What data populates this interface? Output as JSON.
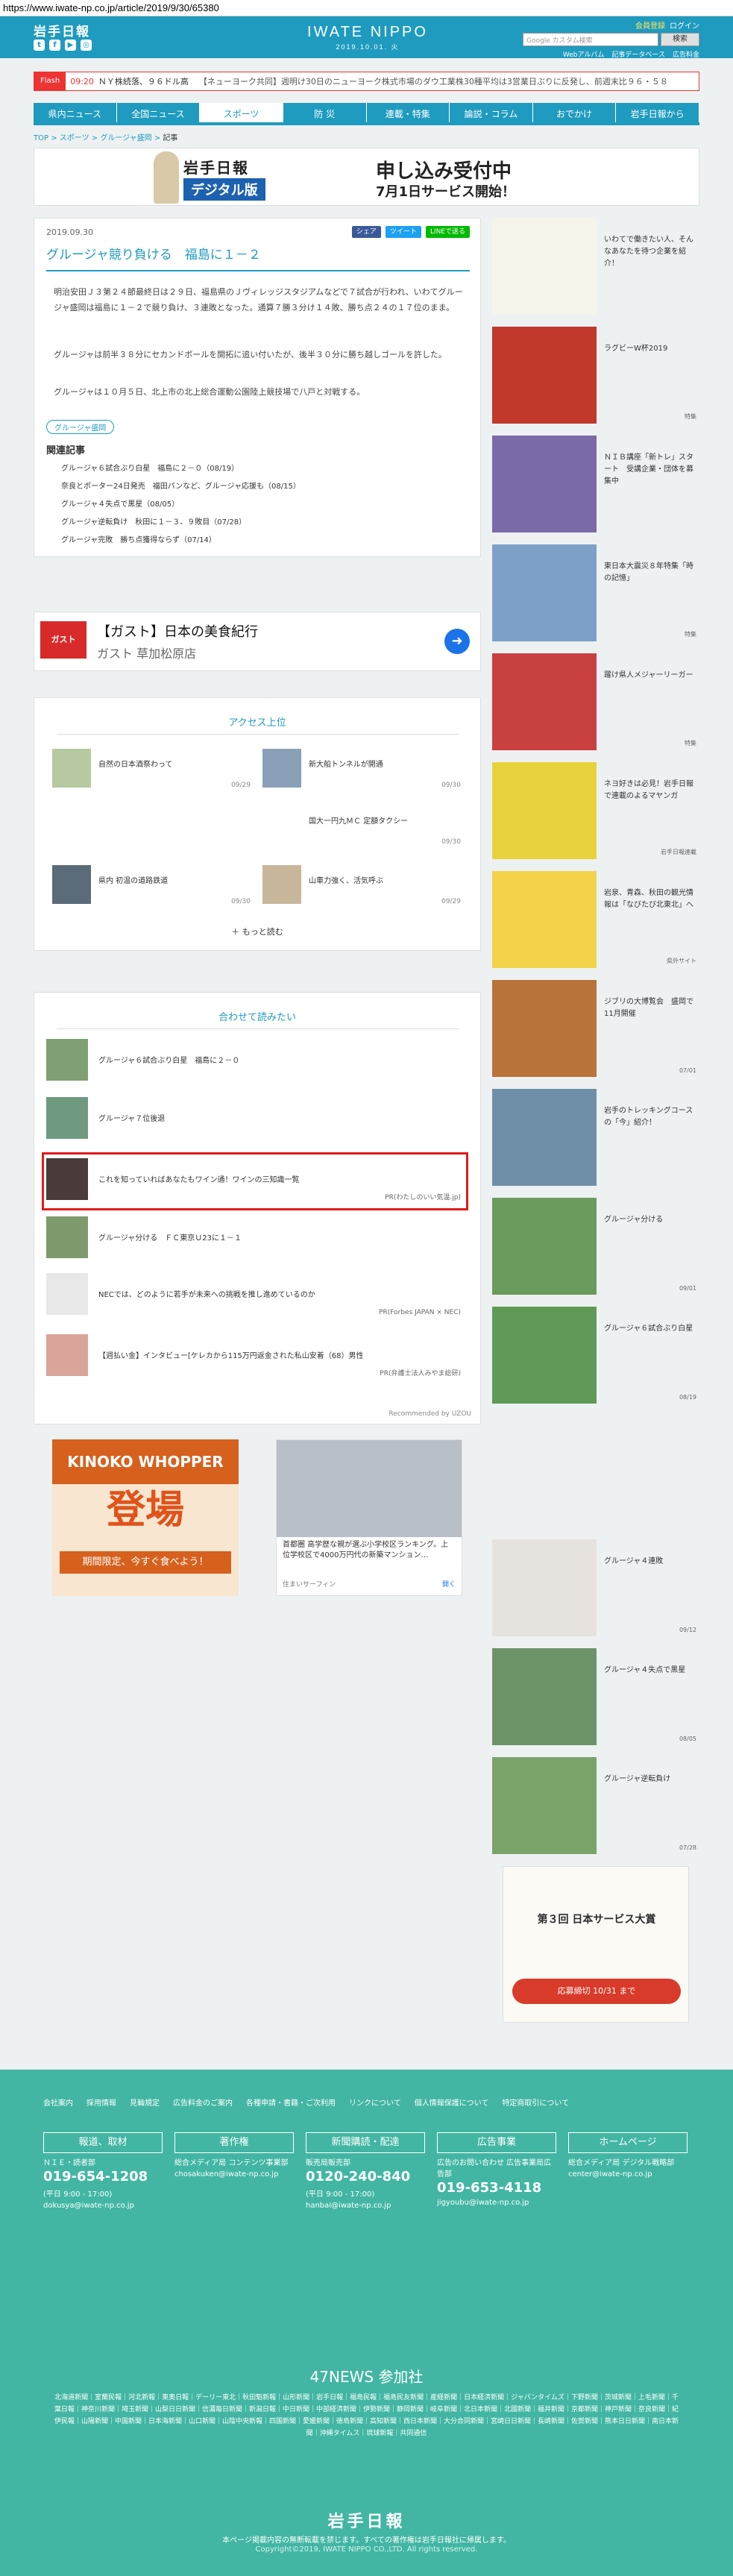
{
  "url": "https://www.iwate-np.co.jp/article/2019/9/30/65380",
  "header": {
    "logo": "岩手日報",
    "brand": "IWATE NIPPO",
    "date": "2019.10.01. 火",
    "member": "会員登録",
    "login": "ログイン",
    "search_placeholder": "Google カスタム検索",
    "search_button": "検索",
    "sublinks": [
      "Webアルバム",
      "記事データベース",
      "広告料金"
    ]
  },
  "flash": {
    "tag": "Flash",
    "time": "09:20",
    "text": "ＮＹ株続落、９６ドル高",
    "text2": "【ネューヨーク共同】週明け30日のニューヨーク株式市場のダウ工業株30種平均は3営業日ぶりに反発し、前週末比９６・５８"
  },
  "nav": [
    "県内ニュース",
    "全国ニュース",
    "スポーツ",
    "防 災",
    "連載・特集",
    "論説・コラム",
    "おでかけ",
    "岩手日報から"
  ],
  "breadcrumb": {
    "items": [
      "TOP",
      "スポーツ",
      "グルージャ盛岡"
    ],
    "current": "記事"
  },
  "banner": {
    "line1": "岩手日報",
    "line2": "デジタル版",
    "line3": "申し込み受付中",
    "line4": "7月1日サービス開始！"
  },
  "article": {
    "date": "2019.09.30",
    "share": [
      "シェア",
      "ツイート",
      "LINEで送る"
    ],
    "title": "グルージャ競り負ける　福島に１－２",
    "paragraphs": [
      "明治安田Ｊ３第２４節最終日は２９日、福島県のＪヴィレッジスタジアムなどで７試合が行われ、いわてグルージャ盛岡は福島に１－２で競り負け、３連敗となった。通算７勝３分け１４敗、勝ち点２４の１７位のまま。",
      "グルージャは前半３８分にセカンドボールを開拓に追い付いたが、後半３０分に勝ち越しゴールを許した。",
      "グルージャは１０月５日、北上市の北上総合運動公園陸上競技場で八戸と対戦する。"
    ],
    "tag": "グルージャ盛岡",
    "related_heading": "関連記事",
    "related": [
      "グルージャ６試合ぶり白星　福島に２－０（08/19）",
      "奈良とポーター24日発売　福田パンなど、グルージャ応援も（08/15）",
      "グルージャ４失点で黒星（08/05）",
      "グルージャ逆転負け　秋田に１－３、９敗目（07/28）",
      "グルージャ完敗　勝ち点獲得ならず（07/14）"
    ]
  },
  "ad_gusto": {
    "logo": "ガスト",
    "title": "【ガスト】日本の美食紀行",
    "subtitle": "ガスト 草加松原店"
  },
  "access": {
    "heading": "アクセス上位",
    "items": [
      {
        "text": "自然の日本酒祭わって",
        "date": "09/29"
      },
      {
        "text": "新大船トンネルが開通",
        "date": "09/30"
      },
      {
        "text": "",
        "date": ""
      },
      {
        "text": "国大一円九ＭＣ 定額タクシー",
        "date": "09/30"
      },
      {
        "text": "県内 初温の道路鉄道",
        "date": "09/30"
      },
      {
        "text": "山車力強く、活気呼ぶ",
        "date": "09/29"
      }
    ],
    "more": "もっと読む"
  },
  "recommend": {
    "heading": "合わせて読みたい",
    "items": [
      {
        "text": "グルージャ６試合ぶり白星　福島に２－０",
        "pr": ""
      },
      {
        "text": "グルージャ７位後退",
        "pr": ""
      },
      {
        "text": "これを知っていればあなたもワイン通！ワインの三知識一覧",
        "pr": "PR(わたしのいい気温.jp)"
      },
      {
        "text": "グルージャ分ける　ＦＣ東京Ｕ23に１－１",
        "pr": ""
      },
      {
        "text": "NECでは、どのように若手が未来への挑戦を推し進めているのか",
        "pr": "PR(Forbes JAPAN × NEC)"
      },
      {
        "text": "【週払い金】インタビュー[ケレカから115万円返金された私山安着（68）男性",
        "pr": "PR(弁護士法人みやま総研)"
      }
    ],
    "powered": "Recommended by UZOU"
  },
  "ad_burger": {
    "title": "KINOKO WHOPPER",
    "sub": "登場",
    "line": "期間限定、今すぐ食べよう！"
  },
  "ad_house": {
    "text": "首都圏 高学歴な親が選ぶ小学校区ランキング。上位学校区で4000万円代の新築マンション…",
    "source": "住まいサーフィン",
    "cta": "開く"
  },
  "sidebar": [
    {
      "text": "いわてで働きたい人、そんなあなたを待つ企業を紹介！",
      "label": ""
    },
    {
      "text": "ラグビーW杯2019",
      "label": "特集"
    },
    {
      "text": "ＮＩＢ講座「新トレ」スタート　受講企業・団体を募集中",
      "label": ""
    },
    {
      "text": "東日本大震災８年特集「時の記憶」",
      "label": "特集"
    },
    {
      "text": "躍け県人メジャーリーガー",
      "label": "特集"
    },
    {
      "text": "ネヨ好きは必見！岩手日報で連載のよるマヤンガ",
      "label": "岩手日報連載"
    },
    {
      "text": "岩泉、青森、秋田の観光情報は「なびたび北東北」へ",
      "label": "県外サイト"
    },
    {
      "text": "ジブリの大博覧会　盛岡で11月開催",
      "label": "07/01"
    },
    {
      "text": "岩手のトレッキングコースの「今」紹介！",
      "label": ""
    },
    {
      "text": "グルージャ分ける",
      "label": "09/01"
    },
    {
      "text": "グルージャ６試合ぶり白星",
      "label": "08/19"
    },
    {
      "text": "グルージャ４連敗",
      "label": "09/12"
    },
    {
      "text": "グルージャ４失点で黒星",
      "label": "08/05"
    },
    {
      "text": "グルージャ逆転負け",
      "label": "07/28"
    }
  ],
  "sidebar_ad": {
    "line1": "第３回 日本サービス大賞",
    "line2": "応募締切 10/31 まで"
  },
  "footer": {
    "links": [
      "会社案内",
      "採用情報",
      "見輪規定",
      "広告料金のご案内",
      "各種申請・書籍・ご次利用",
      "リンクについて",
      "個人情報保護について",
      "特定商取引について"
    ],
    "cols": [
      {
        "head": "報道、取材",
        "sub": "ＮＩＥ・読者部",
        "phone": "019-654-1208",
        "hours": "(平日 9:00 - 17:00)",
        "mail": "dokusya@iwate-np.co.jp"
      },
      {
        "head": "著作権",
        "sub": "総合メディア局 コンテンツ事業部",
        "phone": "",
        "hours": "",
        "mail": "chosakuken@iwate-np.co.jp"
      },
      {
        "head": "新聞購読・配達",
        "sub": "販売局販売部",
        "phone": "0120-240-840",
        "hours": "(平日 9:00 - 17:00)",
        "mail": "hanbai@iwate-np.co.jp"
      },
      {
        "head": "広告事業",
        "sub": "広告のお問い合わせ 広告事業局広告部",
        "phone": "019-653-4118",
        "hours": "",
        "mail": "jigyoubu@iwate-np.co.jp"
      },
      {
        "head": "ホームページ",
        "sub": "総合メディア局 デジタル戦略部",
        "phone": "",
        "hours": "",
        "mail": "center@iwate-np.co.jp"
      }
    ],
    "n47": "47NEWS 参加社",
    "papers": "北海道新聞｜室蘭民報｜河北新報｜東奥日報｜デーリー東北｜秋田魁新報｜山形新聞｜岩手日報｜福島民報｜福島民友新聞｜産経新聞｜日本経済新聞｜ジャパンタイムズ｜下野新聞｜茨城新聞｜上毛新聞｜千葉日報｜神奈川新聞｜埼玉新聞｜山梨日日新聞｜信濃毎日新聞｜新潟日報｜中日新聞｜中部経済新聞｜伊勢新聞｜静岡新聞｜岐阜新聞｜北日本新聞｜北國新聞｜福井新聞｜京都新聞｜神戸新聞｜奈良新聞｜紀伊民報｜山陽新聞｜中国新聞｜日本海新聞｜山口新聞｜山陰中央新報｜四国新聞｜愛媛新聞｜徳島新聞｜高知新聞｜西日本新聞｜大分合同新聞｜宮崎日日新聞｜長崎新聞｜佐賀新聞｜熊本日日新聞｜南日本新聞｜沖縄タイムス｜琉球新報｜共同通信",
    "logo": "岩手日報",
    "copy": "本ページ掲載内容の無断転載を禁じます。すべての著作権は岩手日報社に帰属します。",
    "copy2": "Copyright©2019, IWATE NIPPO CO.,LTD. All rights reserved."
  },
  "colors": {
    "brand": "#1f9bbf",
    "footer": "#42b6a3",
    "highlight": "#e01b1b"
  }
}
